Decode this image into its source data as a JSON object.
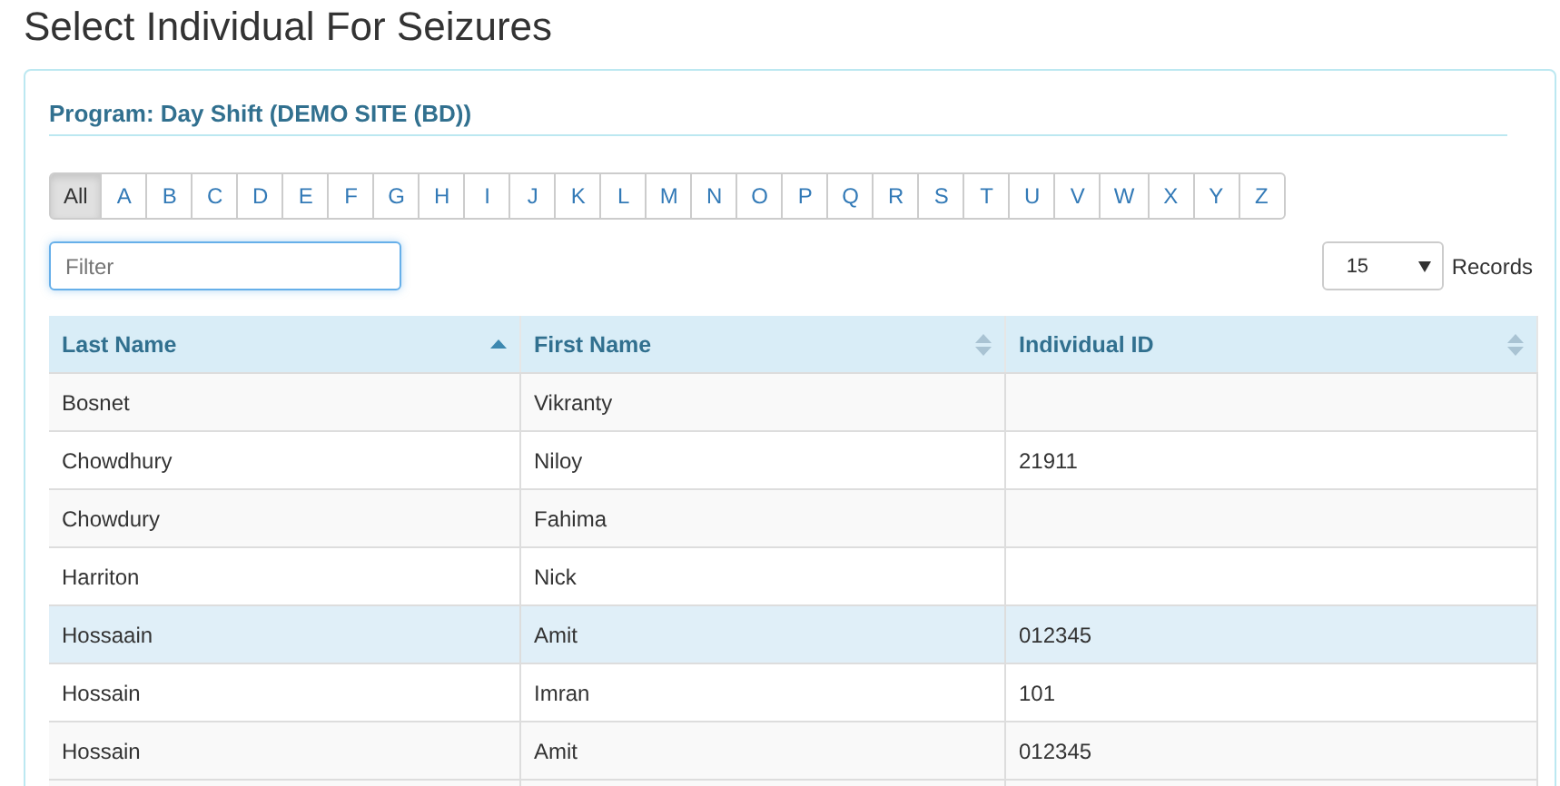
{
  "page_title": "Select Individual For Seizures",
  "program_heading": "Program: Day Shift (DEMO SITE (BD))",
  "letters": [
    {
      "label": "All",
      "selected": true
    },
    {
      "label": "A",
      "selected": false
    },
    {
      "label": "B",
      "selected": false
    },
    {
      "label": "C",
      "selected": false
    },
    {
      "label": "D",
      "selected": false
    },
    {
      "label": "E",
      "selected": false
    },
    {
      "label": "F",
      "selected": false
    },
    {
      "label": "G",
      "selected": false
    },
    {
      "label": "H",
      "selected": false
    },
    {
      "label": "I",
      "selected": false
    },
    {
      "label": "J",
      "selected": false
    },
    {
      "label": "K",
      "selected": false
    },
    {
      "label": "L",
      "selected": false
    },
    {
      "label": "M",
      "selected": false
    },
    {
      "label": "N",
      "selected": false
    },
    {
      "label": "O",
      "selected": false
    },
    {
      "label": "P",
      "selected": false
    },
    {
      "label": "Q",
      "selected": false
    },
    {
      "label": "R",
      "selected": false
    },
    {
      "label": "S",
      "selected": false
    },
    {
      "label": "T",
      "selected": false
    },
    {
      "label": "U",
      "selected": false
    },
    {
      "label": "V",
      "selected": false
    },
    {
      "label": "W",
      "selected": false
    },
    {
      "label": "X",
      "selected": false
    },
    {
      "label": "Y",
      "selected": false
    },
    {
      "label": "Z",
      "selected": false
    }
  ],
  "filter": {
    "placeholder": "Filter"
  },
  "records": {
    "value": "15",
    "label": "Records"
  },
  "table": {
    "columns": [
      {
        "label": "Last Name",
        "sorted": true
      },
      {
        "label": "First Name",
        "sorted": false
      },
      {
        "label": "Individual ID",
        "sorted": false
      }
    ],
    "rows": [
      {
        "cells": [
          "Bosnet",
          "Vikranty",
          ""
        ],
        "highlighted": false
      },
      {
        "cells": [
          "Chowdhury",
          "Niloy",
          "21911"
        ],
        "highlighted": false
      },
      {
        "cells": [
          "Chowdury",
          "Fahima",
          ""
        ],
        "highlighted": false
      },
      {
        "cells": [
          "Harriton",
          "Nick",
          ""
        ],
        "highlighted": false
      },
      {
        "cells": [
          "Hossaain",
          "Amit",
          "012345"
        ],
        "highlighted": true
      },
      {
        "cells": [
          "Hossain",
          "Imran",
          "101"
        ],
        "highlighted": false
      },
      {
        "cells": [
          "Hossain",
          "Amit",
          "012345"
        ],
        "highlighted": false
      }
    ]
  }
}
